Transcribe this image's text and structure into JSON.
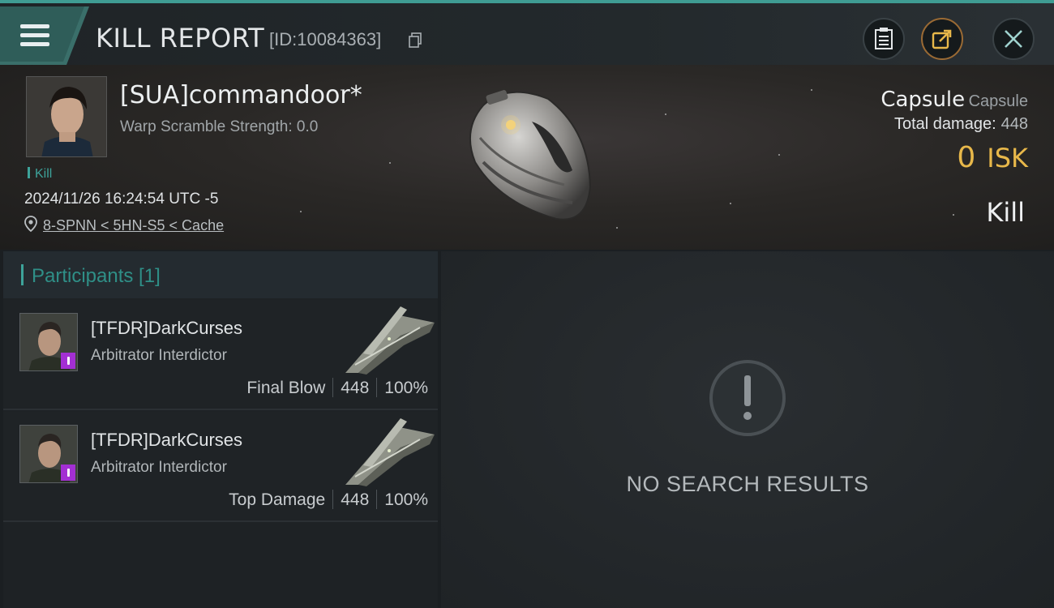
{
  "header": {
    "title": "KILL REPORT",
    "report_id": "[ID:10084363]",
    "icons": [
      "menu-icon",
      "copy-icon",
      "clipboard-icon",
      "share-icon",
      "close-icon"
    ]
  },
  "victim": {
    "name": "[SUA]commandoor*",
    "subtitle": "Warp Scramble Strength: 0.0",
    "tag": "Kill",
    "datetime": "2024/11/26 16:24:54 UTC -5",
    "location": "8-SPNN < 5HN-S5 < Cache"
  },
  "summary": {
    "ship_class": "Capsule",
    "ship_name": "Capsule",
    "total_damage_label": "Total damage:",
    "total_damage_value": "448",
    "isk_value": "0",
    "isk_unit": "ISK",
    "result": "Kill"
  },
  "participants": {
    "title": "Participants [1]",
    "items": [
      {
        "name": "[TFDR]DarkCurses",
        "ship": "Arbitrator Interdictor",
        "role": "Final Blow",
        "damage": "448",
        "percent": "100%"
      },
      {
        "name": "[TFDR]DarkCurses",
        "ship": "Arbitrator Interdictor",
        "role": "Top Damage",
        "damage": "448",
        "percent": "100%"
      }
    ]
  },
  "empty_state": {
    "text": "NO SEARCH RESULTS"
  },
  "colors": {
    "accent": "#3da39a",
    "isk": "#e8b84a",
    "badge": "#a32fd3"
  }
}
